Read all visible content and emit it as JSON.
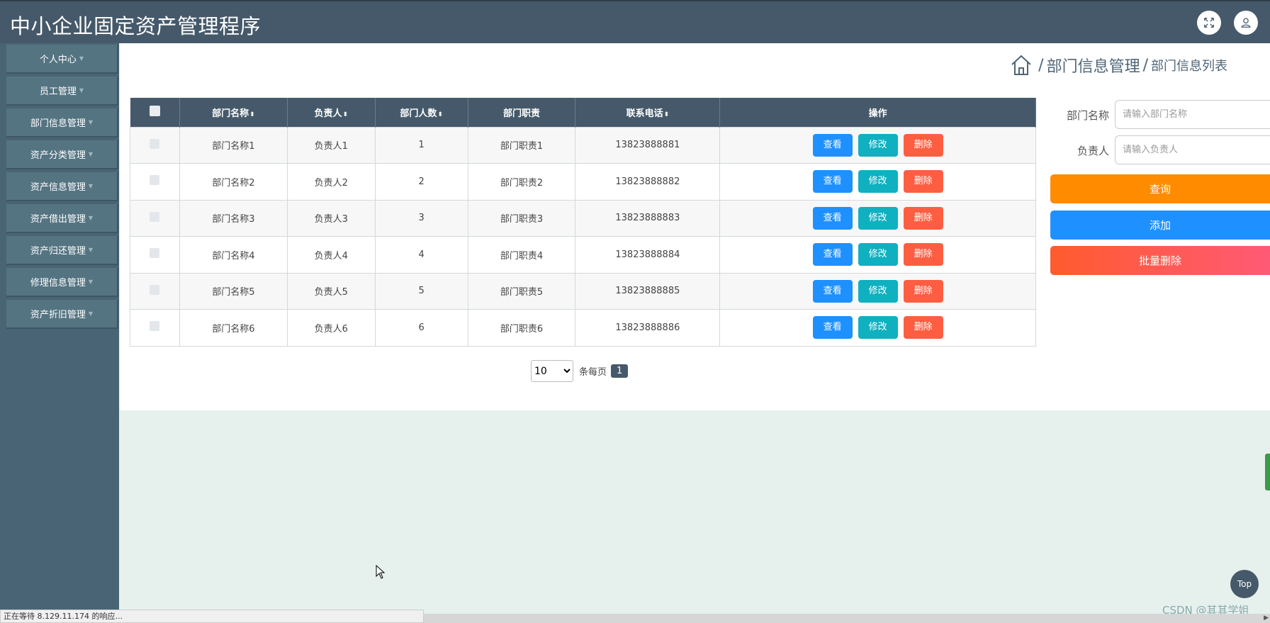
{
  "app": {
    "title": "中小企业固定资产管理程序"
  },
  "header_icons": {
    "fullscreen": "fullscreen-icon",
    "user": "user-icon"
  },
  "sidebar": {
    "items": [
      {
        "label": "个人中心"
      },
      {
        "label": "员工管理"
      },
      {
        "label": "部门信息管理"
      },
      {
        "label": "资产分类管理"
      },
      {
        "label": "资产信息管理"
      },
      {
        "label": "资产借出管理"
      },
      {
        "label": "资产归还管理"
      },
      {
        "label": "修理信息管理"
      },
      {
        "label": "资产折旧管理"
      }
    ],
    "caret": "▼"
  },
  "breadcrumb": {
    "sep": "/",
    "level1": "部门信息管理",
    "level2": "部门信息列表"
  },
  "table": {
    "headers": [
      "部门名称",
      "负责人",
      "部门人数",
      "部门职责",
      "联系电话",
      "操作"
    ],
    "sort_glyph": "⬍",
    "rows": [
      {
        "name": "部门名称1",
        "leader": "负责人1",
        "count": "1",
        "duty": "部门职责1",
        "phone": "13823888881"
      },
      {
        "name": "部门名称2",
        "leader": "负责人2",
        "count": "2",
        "duty": "部门职责2",
        "phone": "13823888882"
      },
      {
        "name": "部门名称3",
        "leader": "负责人3",
        "count": "3",
        "duty": "部门职责3",
        "phone": "13823888883"
      },
      {
        "name": "部门名称4",
        "leader": "负责人4",
        "count": "4",
        "duty": "部门职责4",
        "phone": "13823888884"
      },
      {
        "name": "部门名称5",
        "leader": "负责人5",
        "count": "5",
        "duty": "部门职责5",
        "phone": "13823888885"
      },
      {
        "name": "部门名称6",
        "leader": "负责人6",
        "count": "6",
        "duty": "部门职责6",
        "phone": "13823888886"
      }
    ],
    "actions": {
      "view": "查看",
      "edit": "修改",
      "delete": "删除"
    }
  },
  "pager": {
    "page_size": "10",
    "per_page_label": "条每页",
    "current_page": "1"
  },
  "search": {
    "name_label": "部门名称",
    "name_placeholder": "请输入部门名称",
    "leader_label": "负责人",
    "leader_placeholder": "请输入负责人",
    "query_label": "查询",
    "add_label": "添加",
    "bulk_delete_label": "批量删除"
  },
  "misc": {
    "top_label": "Top",
    "status_text": "正在等待 8.129.11.174 的响应...",
    "watermark": "CSDN @其其学姐"
  },
  "colors": {
    "header_bg": "#45596a",
    "sidebar_bg": "#496575",
    "view_btn": "#1e90ff",
    "edit_btn": "#0fb0c0",
    "delete_btn": "#fd5e42",
    "query_btn": "#ff8c00"
  }
}
